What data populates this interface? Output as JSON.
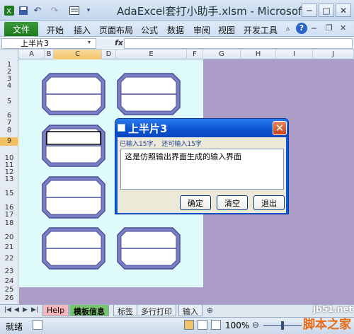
{
  "window": {
    "title": "AdaExcel套打小助手.xlsm - Microsof...",
    "controls": [
      "─",
      "□",
      "✕"
    ]
  },
  "quick_access": {
    "save_icon": "save-icon",
    "undo_icon": "undo-icon",
    "redo_icon": "redo-icon",
    "form_icon": "form-icon"
  },
  "ribbon": {
    "file_label": "文件",
    "tabs": [
      "开始",
      "插入",
      "页面布局",
      "公式",
      "数据",
      "审阅",
      "视图",
      "开发工具"
    ]
  },
  "formula_bar": {
    "name_box": "上半片3",
    "fx_label": "fx",
    "value": ""
  },
  "columns": [
    "A",
    "B",
    "C",
    "D",
    "E",
    "F",
    "G",
    "H",
    "I",
    "J"
  ],
  "selected_column": "C",
  "rows": [
    "1",
    "2",
    "3",
    "4",
    "5",
    "6",
    "7",
    "8",
    "9",
    "10",
    "11",
    "12",
    "13",
    "15",
    "16",
    "17",
    "18",
    "20",
    "21",
    "22",
    "23",
    "24",
    "25",
    "26"
  ],
  "selected_row": "9",
  "sheet_tabs": [
    "Help",
    "模板信息",
    "标签",
    "多行打印",
    "输入"
  ],
  "status": {
    "ready": "就绪",
    "zoom": "100%"
  },
  "dialog": {
    "title": "上半片3",
    "count_text": "已输入15字， 还可输入15字",
    "content": "这是仿照输出界面生成的输入界面",
    "buttons": {
      "ok": "确定",
      "clear": "清空",
      "exit": "退出"
    },
    "close_symbol": "✕"
  },
  "watermark": {
    "line1": "jb51.net",
    "line2": "脚本之家"
  },
  "colors": {
    "sheet_bg": "#dffafb",
    "outside_bg": "#ab9cc7",
    "label_fill": "#7a7fc4",
    "dialog_title": "#0a5ad8",
    "file_tab": "#2a8a2a"
  }
}
